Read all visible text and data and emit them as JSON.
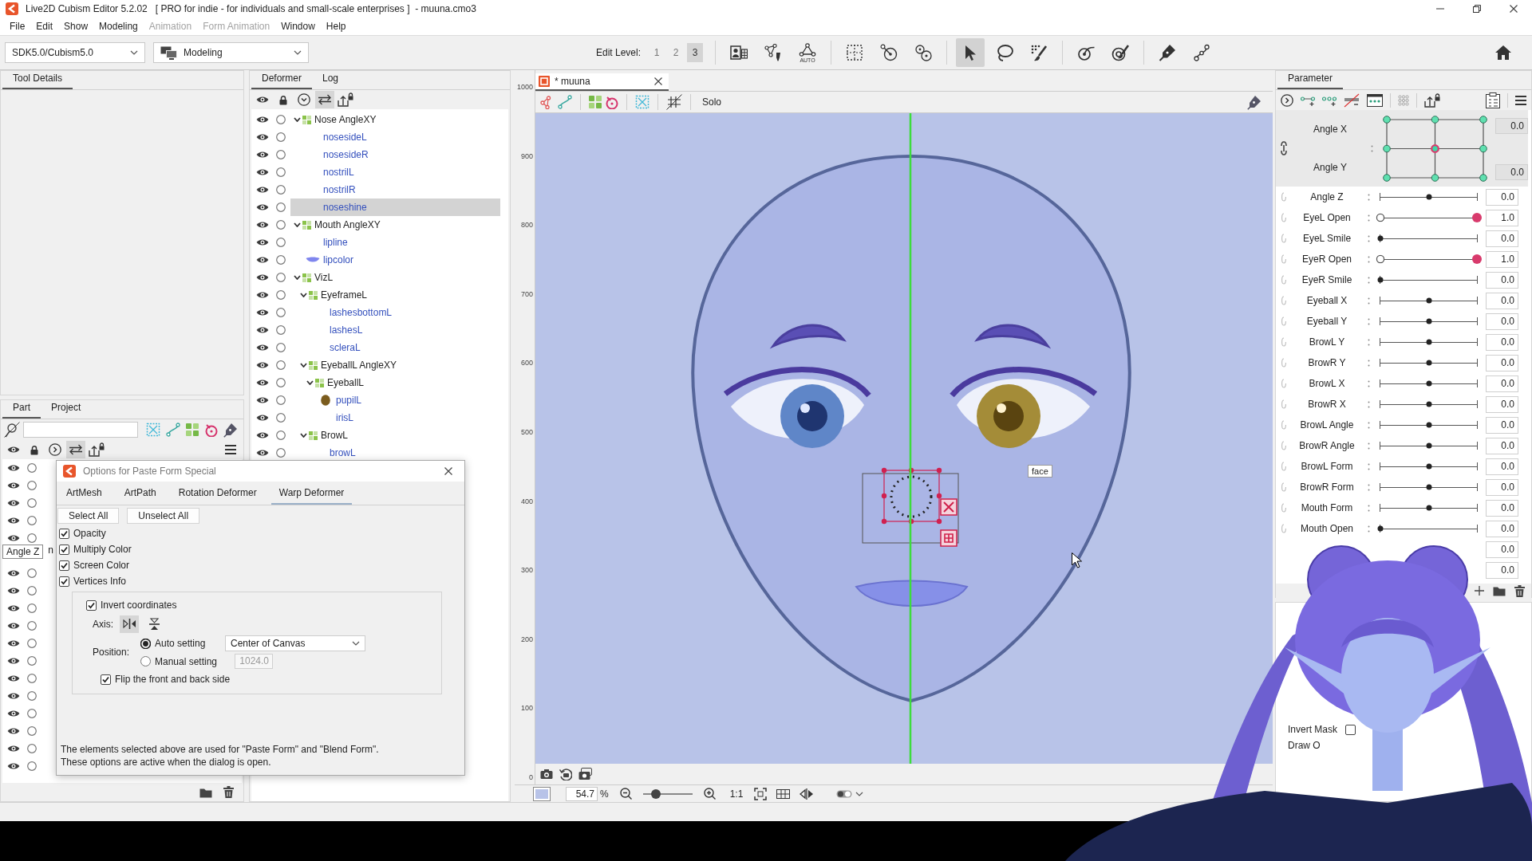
{
  "window": {
    "title": "Live2D Cubism Editor 5.2.02   [ PRO for indie - for individuals and small-scale enterprises ]  - muuna.cmo3"
  },
  "menu": [
    {
      "label": "File",
      "disabled": false
    },
    {
      "label": "Edit",
      "disabled": false
    },
    {
      "label": "Show",
      "disabled": false
    },
    {
      "label": "Modeling",
      "disabled": false
    },
    {
      "label": "Animation",
      "disabled": true
    },
    {
      "label": "Form Animation",
      "disabled": true
    },
    {
      "label": "Window",
      "disabled": false
    },
    {
      "label": "Help",
      "disabled": false
    }
  ],
  "toolbar": {
    "sdk": "SDK5.0/Cubism5.0",
    "workspace": "Modeling",
    "edit_level_label": "Edit Level:",
    "edit_levels": [
      {
        "label": "1",
        "selected": false
      },
      {
        "label": "2",
        "selected": false
      },
      {
        "label": "3",
        "selected": true
      }
    ],
    "tool_groups": [
      [
        {
          "selected": false
        },
        {
          "selected": false
        },
        {
          "selected": false,
          "caption": "AUTO"
        }
      ],
      [
        {
          "selected": false
        },
        {
          "selected": false
        },
        {
          "selected": false
        }
      ],
      [
        {
          "selected": true
        },
        {
          "selected": false
        },
        {
          "selected": false
        }
      ],
      [
        {
          "selected": false
        },
        {
          "selected": false
        }
      ],
      [
        {
          "selected": false
        },
        {
          "selected": false
        }
      ]
    ]
  },
  "tool_details": {
    "tabs": [
      {
        "label": "Tool Details",
        "selected": true
      }
    ]
  },
  "part_panel": {
    "tabs": [
      {
        "label": "Part",
        "selected": true
      },
      {
        "label": "Project",
        "selected": false
      }
    ],
    "toolbar": [
      {
        "selected": false
      },
      {
        "selected": false
      },
      {
        "selected": false
      },
      {
        "selected": true
      },
      {
        "selected": false
      }
    ],
    "rows": [
      {
        "visible": true,
        "locked": false
      },
      {
        "visible": true,
        "locked": false
      },
      {
        "visible": true,
        "locked": false
      },
      {
        "visible": true,
        "locked": false
      },
      {
        "visible": true,
        "locked": false
      },
      {
        "visible": true,
        "locked": false
      },
      {
        "visible": true,
        "locked": false
      },
      {
        "visible": true,
        "locked": false
      },
      {
        "visible": true,
        "locked": false
      },
      {
        "visible": true,
        "locked": false
      },
      {
        "visible": true,
        "locked": false
      },
      {
        "visible": true,
        "locked": false
      },
      {
        "visible": true,
        "locked": false
      },
      {
        "visible": true,
        "locked": false
      },
      {
        "visible": true,
        "locked": false
      },
      {
        "visible": true,
        "locked": false
      },
      {
        "visible": true,
        "locked": false
      }
    ],
    "tooltip": "Angle Z",
    "cut_text": "n"
  },
  "deformer_panel": {
    "tabs": [
      {
        "label": "Deformer",
        "selected": true
      },
      {
        "label": "Log",
        "selected": false
      }
    ],
    "toolbar": [
      {
        "selected": false
      },
      {
        "selected": false
      },
      {
        "selected": false
      },
      {
        "selected": true
      },
      {
        "selected": false
      }
    ],
    "tree": [
      {
        "label": "Nose AngleXY",
        "kind": "warp",
        "expanded": true,
        "visible": true,
        "locked": false,
        "selected": false,
        "children": [
          {
            "label": "nosesideL",
            "kind": "mesh",
            "visible": true,
            "locked": false,
            "selected": false
          },
          {
            "label": "nosesideR",
            "kind": "mesh",
            "visible": true,
            "locked": false,
            "selected": false
          },
          {
            "label": "nostrilL",
            "kind": "mesh",
            "visible": true,
            "locked": false,
            "selected": false
          },
          {
            "label": "nostrilR",
            "kind": "mesh",
            "visible": true,
            "locked": false,
            "selected": false
          },
          {
            "label": "noseshine",
            "kind": "mesh",
            "visible": true,
            "locked": false,
            "selected": true
          }
        ]
      },
      {
        "label": "Mouth AngleXY",
        "kind": "warp",
        "expanded": true,
        "visible": true,
        "locked": false,
        "selected": false,
        "children": [
          {
            "label": "lipline",
            "kind": "mesh",
            "visible": true,
            "locked": false,
            "selected": false
          },
          {
            "label": "lipcolor",
            "kind": "lipmesh",
            "visible": true,
            "locked": false,
            "selected": false
          }
        ]
      },
      {
        "label": "VizL",
        "kind": "warp",
        "expanded": true,
        "visible": true,
        "locked": false,
        "selected": false,
        "children": [
          {
            "label": "EyeframeL",
            "kind": "warp",
            "expanded": true,
            "visible": true,
            "locked": false,
            "selected": false,
            "children": [
              {
                "label": "lashesbottomL",
                "kind": "mesh",
                "visible": true,
                "locked": false,
                "selected": false
              },
              {
                "label": "lashesL",
                "kind": "mesh",
                "visible": true,
                "locked": false,
                "selected": false
              },
              {
                "label": "scleraL",
                "kind": "mesh",
                "visible": true,
                "locked": false,
                "selected": false
              }
            ]
          },
          {
            "label": "EyeballL AngleXY",
            "kind": "warp",
            "expanded": true,
            "visible": true,
            "locked": false,
            "selected": false,
            "children": [
              {
                "label": "EyeballL",
                "kind": "warp",
                "expanded": true,
                "visible": true,
                "locked": false,
                "selected": false,
                "children": [
                  {
                    "label": "pupilL",
                    "kind": "discmesh",
                    "visible": true,
                    "locked": false,
                    "selected": false
                  },
                  {
                    "label": "irisL",
                    "kind": "mesh",
                    "visible": true,
                    "locked": false,
                    "selected": false
                  }
                ]
              }
            ]
          },
          {
            "label": "BrowL",
            "kind": "warp",
            "expanded": true,
            "visible": true,
            "locked": false,
            "selected": false,
            "children": [
              {
                "label": "browL",
                "kind": "mesh",
                "visible": true,
                "locked": false,
                "selected": false
              }
            ]
          }
        ]
      }
    ]
  },
  "canvas": {
    "tab": "* muuna",
    "toolbar_text": "Solo",
    "ruler": [
      "1000",
      "900",
      "800",
      "700",
      "600",
      "500",
      "400",
      "300",
      "200",
      "100",
      "0"
    ],
    "deformer_label": "face",
    "zoom": {
      "value": "54.7",
      "unit": "%",
      "level": 0.26,
      "actual_size": "1:1"
    }
  },
  "parameter_panel": {
    "tabs": [
      {
        "label": "Parameter",
        "selected": true
      }
    ],
    "grid": {
      "names": [
        "Angle X",
        "Angle Y"
      ],
      "values": [
        "0.0",
        "0.0"
      ],
      "points": [
        {
          "selected": false
        },
        {
          "selected": false
        },
        {
          "selected": false
        },
        {
          "selected": false
        },
        {
          "selected": true
        },
        {
          "selected": false
        },
        {
          "selected": false
        },
        {
          "selected": false
        },
        {
          "selected": false
        }
      ]
    },
    "rows": [
      {
        "name": "Angle Z",
        "kind": "slider",
        "level": 0.5,
        "value": "0.0"
      },
      {
        "name": "EyeL Open",
        "kind": "keyed",
        "level": 1,
        "value": "1.0"
      },
      {
        "name": "EyeL Smile",
        "kind": "slider",
        "level": 0,
        "value": "0.0"
      },
      {
        "name": "EyeR Open",
        "kind": "keyed",
        "level": 1,
        "value": "1.0"
      },
      {
        "name": "EyeR Smile",
        "kind": "slider",
        "level": 0,
        "value": "0.0"
      },
      {
        "name": "Eyeball X",
        "kind": "slider",
        "level": 0.5,
        "value": "0.0"
      },
      {
        "name": "Eyeball Y",
        "kind": "slider",
        "level": 0.5,
        "value": "0.0"
      },
      {
        "name": "BrowL Y",
        "kind": "slider",
        "level": 0.5,
        "value": "0.0"
      },
      {
        "name": "BrowR Y",
        "kind": "slider",
        "level": 0.5,
        "value": "0.0"
      },
      {
        "name": "BrowL X",
        "kind": "slider",
        "level": 0.5,
        "value": "0.0"
      },
      {
        "name": "BrowR X",
        "kind": "slider",
        "level": 0.5,
        "value": "0.0"
      },
      {
        "name": "BrowL Angle",
        "kind": "slider",
        "level": 0.5,
        "value": "0.0"
      },
      {
        "name": "BrowR Angle",
        "kind": "slider",
        "level": 0.5,
        "value": "0.0"
      },
      {
        "name": "BrowL Form",
        "kind": "slider",
        "level": 0.5,
        "value": "0.0"
      },
      {
        "name": "BrowR Form",
        "kind": "slider",
        "level": 0.5,
        "value": "0.0"
      },
      {
        "name": "Mouth Form",
        "kind": "slider",
        "level": 0.5,
        "value": "0.0"
      },
      {
        "name": "Mouth Open",
        "kind": "slider",
        "level": 0,
        "value": "0.0"
      },
      {
        "kind": "value",
        "value": "0.0"
      },
      {
        "kind": "value",
        "value": "0.0"
      }
    ]
  },
  "inspector": {
    "items": [
      {
        "kind": "checkbox",
        "label": "Invert Mask",
        "checked": false
      },
      {
        "kind": "label",
        "label": "Draw O"
      }
    ]
  },
  "dialog": {
    "title": "Options for Paste Form Special",
    "tabs": [
      {
        "label": "ArtMesh",
        "selected": false
      },
      {
        "label": "ArtPath",
        "selected": false
      },
      {
        "label": "Rotation Deformer",
        "selected": false
      },
      {
        "label": "Warp Deformer",
        "selected": true
      }
    ],
    "buttons": [
      "Select All",
      "Unselect All"
    ],
    "options": [
      {
        "label": "Opacity",
        "checked": true
      },
      {
        "label": "Multiply Color",
        "checked": true
      },
      {
        "label": "Screen Color",
        "checked": true
      },
      {
        "label": "Vertices Info",
        "checked": true
      }
    ],
    "invert": {
      "label": "Invert coordinates",
      "checked": true,
      "axis_label": "Axis:",
      "axes": [
        {
          "selected": true
        },
        {
          "selected": false
        }
      ],
      "position_label": "Position:",
      "modes": [
        {
          "label": "Auto setting",
          "selected": true
        },
        {
          "label": "Manual setting",
          "selected": false
        }
      ],
      "origin": "Center of Canvas",
      "manual_field": {
        "value": "1024.0",
        "disabled": true
      },
      "flip": {
        "label": "Flip the front and back side",
        "checked": true
      }
    },
    "note": [
      "The elements selected above are used for \"Paste Form\" and \"Blend Form\".",
      "These options are active when the dialog is open."
    ]
  }
}
